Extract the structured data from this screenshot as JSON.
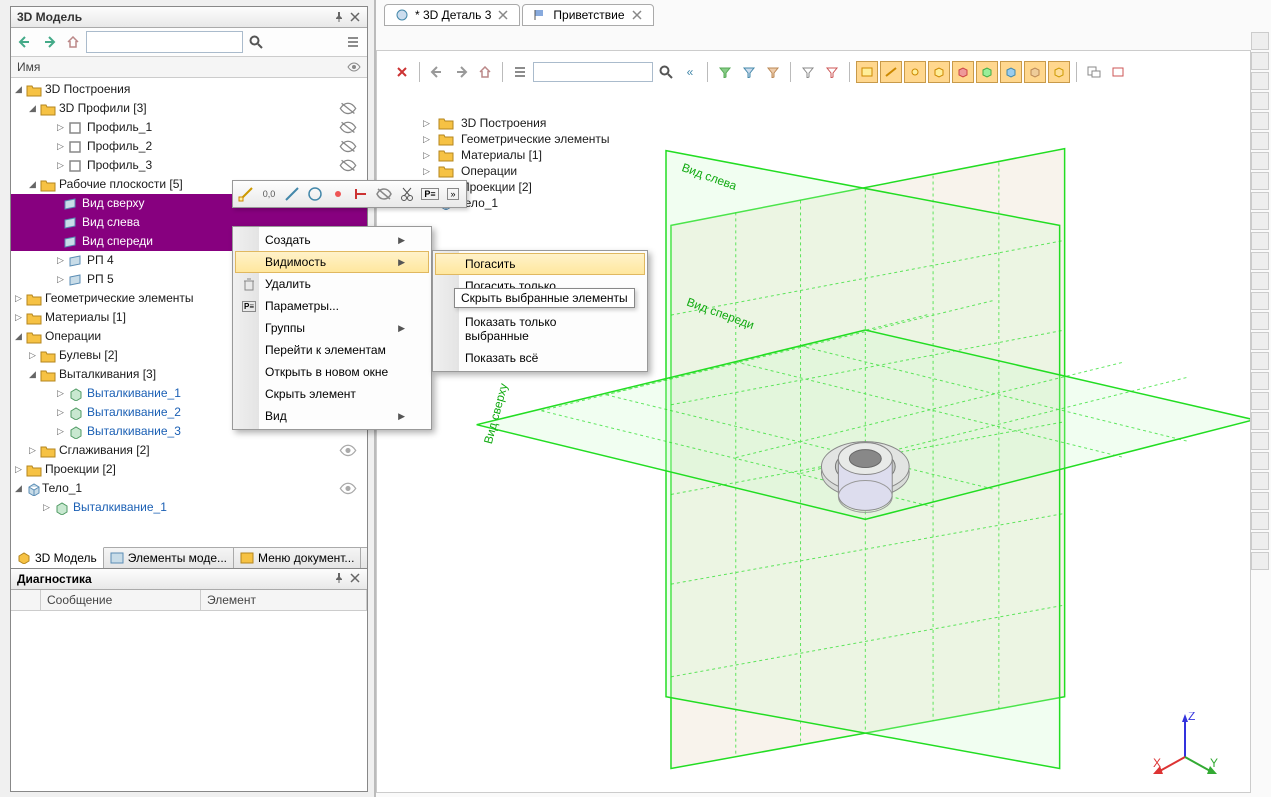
{
  "panel": {
    "title": "3D Модель",
    "column_name": "Имя",
    "tree": {
      "root": "3D Построения",
      "profiles": {
        "label": "3D Профили [3]",
        "items": [
          "Профиль_1",
          "Профиль_2",
          "Профиль_3"
        ]
      },
      "planes": {
        "label": "Рабочие плоскости [5]",
        "items": [
          "Вид сверху",
          "Вид слева",
          "Вид спереди",
          "РП 4",
          "РП 5"
        ]
      },
      "geom": "Геометрические элементы",
      "materials": "Материалы [1]",
      "operations": "Операции",
      "booleans": "Булевы [2]",
      "extrusions": {
        "label": "Выталкивания [3]",
        "items": [
          "Выталкивание_1",
          "Выталкивание_2",
          "Выталкивание_3"
        ]
      },
      "smoothings": "Сглаживания [2]",
      "projections": "Проекции [2]",
      "body": "Тело_1",
      "body_item": "Выталкивание_1"
    },
    "bottom_tabs": [
      "3D Модель",
      "Элементы моде...",
      "Меню документ..."
    ]
  },
  "diagnostics": {
    "title": "Диагностика",
    "columns": [
      "Сообщение",
      "Элемент"
    ]
  },
  "viewport": {
    "tabs": [
      {
        "label": "* 3D Деталь 3"
      },
      {
        "label": "Приветствие"
      }
    ],
    "scene_tree": [
      "3D Построения",
      "Геометрические элементы",
      "Материалы [1]",
      "Операции",
      "Проекции [2]",
      "Тело_1"
    ],
    "plane_labels": {
      "left": "Вид слева",
      "front": "Вид спереди",
      "top": "Вид сверху"
    },
    "axes": {
      "x": "X",
      "y": "Y",
      "z": "Z"
    }
  },
  "context_menu": {
    "items": [
      {
        "label": "Создать",
        "arrow": true
      },
      {
        "label": "Видимость",
        "arrow": true,
        "highlighted": true
      },
      {
        "label": "Удалить",
        "icon": "delete-icon"
      },
      {
        "label": "Параметры...",
        "icon": "properties-icon"
      },
      {
        "label": "Группы",
        "arrow": true
      },
      {
        "label": "Перейти к элементам"
      },
      {
        "label": "Открыть в новом окне"
      },
      {
        "label": "Скрыть элемент"
      },
      {
        "label": "Вид",
        "arrow": true
      }
    ]
  },
  "submenu": {
    "items": [
      {
        "label": "Погасить",
        "highlighted": true
      },
      {
        "label": "Погасить только выбранные"
      },
      {
        "label": "Показать только выбранные"
      },
      {
        "label": "Показать всё"
      }
    ],
    "tooltip": "Скрыть выбранные элементы"
  }
}
